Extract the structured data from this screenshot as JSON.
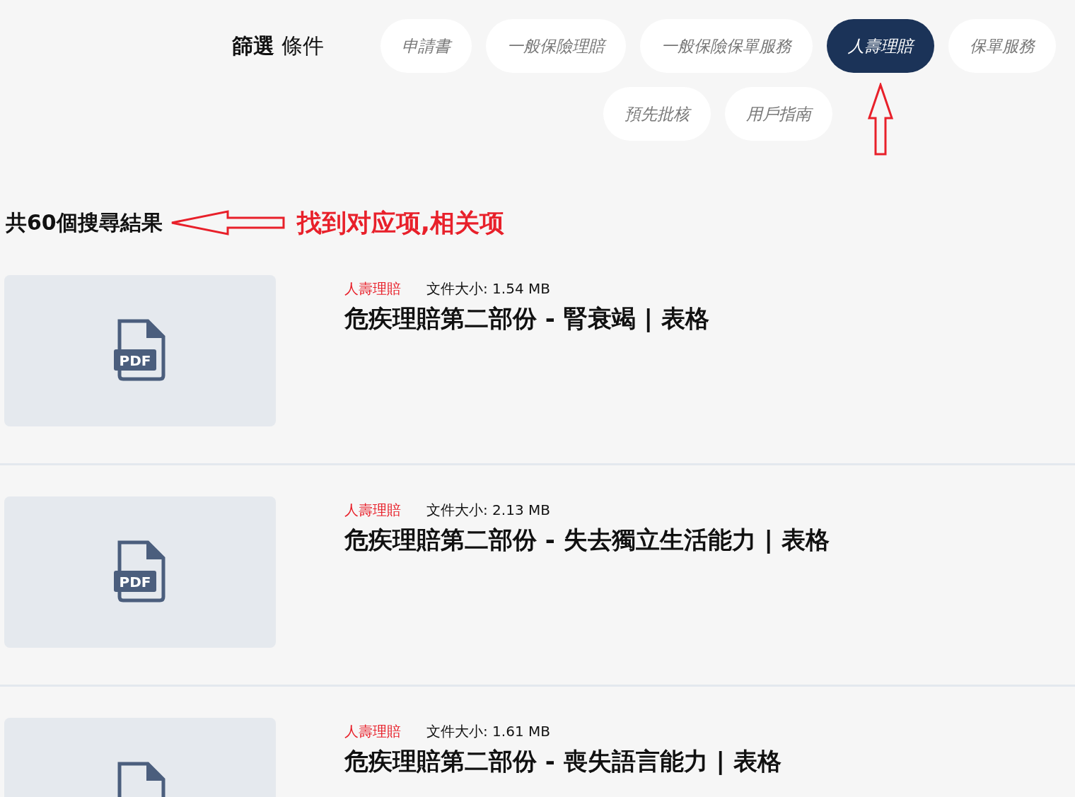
{
  "filter": {
    "label_bold": "篩選",
    "label": "條件",
    "options": [
      {
        "label": "申請書",
        "selected": false
      },
      {
        "label": "一般保險理賠",
        "selected": false
      },
      {
        "label": "一般保險保單服務",
        "selected": false
      },
      {
        "label": "人壽理賠",
        "selected": true
      },
      {
        "label": "保單服務",
        "selected": false
      },
      {
        "label": "預先批核",
        "selected": false
      },
      {
        "label": "用戶指南",
        "selected": false
      }
    ]
  },
  "results": {
    "count_text": "共60個搜尋結果",
    "annotation": "找到对应项,相关项",
    "items": [
      {
        "category": "人壽理賠",
        "file_size": "文件大小: 1.54 MB",
        "title": "危疾理賠第二部份 - 腎衰竭 | 表格",
        "file_type": "PDF"
      },
      {
        "category": "人壽理賠",
        "file_size": "文件大小: 2.13 MB",
        "title": "危疾理賠第二部份 - 失去獨立生活能力 | 表格",
        "file_type": "PDF"
      },
      {
        "category": "人壽理賠",
        "file_size": "文件大小: 1.61 MB",
        "title": "危疾理賠第二部份 - 喪失語言能力 | 表格"
      }
    ]
  }
}
